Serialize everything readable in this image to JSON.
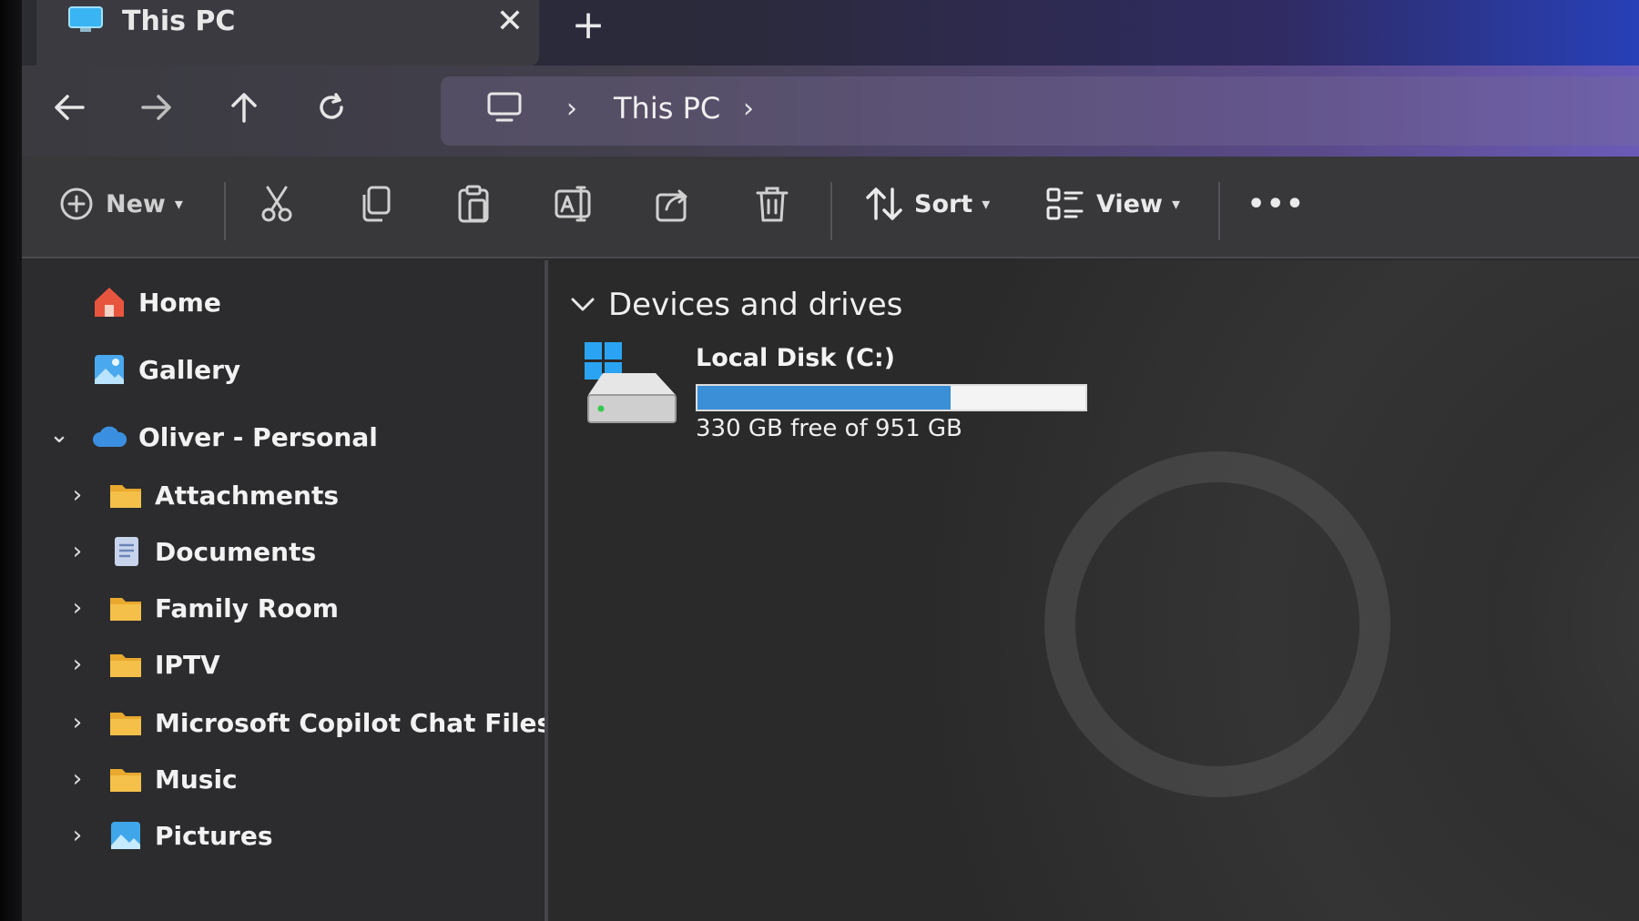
{
  "tab": {
    "title": "This PC",
    "close_glyph": "✕",
    "new_glyph": "+"
  },
  "address": {
    "segments": [
      "This PC"
    ]
  },
  "toolbar": {
    "new_label": "New",
    "sort_label": "Sort",
    "view_label": "View",
    "more_glyph": "•••"
  },
  "icons": {
    "back": "arrow-left-icon",
    "forward": "arrow-right-icon",
    "up": "arrow-up-icon",
    "refresh": "refresh-icon",
    "cut": "scissors-icon",
    "copy": "copy-icon",
    "paste": "clipboard-icon",
    "rename": "rename-icon",
    "share": "share-icon",
    "delete": "trash-icon"
  },
  "sidebar": {
    "items": [
      {
        "label": "Home",
        "icon": "home-icon"
      },
      {
        "label": "Gallery",
        "icon": "gallery-icon"
      },
      {
        "label": "Oliver - Personal",
        "icon": "cloud-icon"
      },
      {
        "label": "Attachments",
        "icon": "folder-icon"
      },
      {
        "label": "Documents",
        "icon": "documents-icon"
      },
      {
        "label": "Family Room",
        "icon": "folder-icon"
      },
      {
        "label": "IPTV",
        "icon": "folder-icon"
      },
      {
        "label": "Microsoft Copilot Chat Files",
        "icon": "folder-icon"
      },
      {
        "label": "Music",
        "icon": "folder-icon"
      },
      {
        "label": "Pictures",
        "icon": "pictures-icon"
      }
    ]
  },
  "main": {
    "group_title": "Devices and drives",
    "drives": [
      {
        "name": "Local Disk (C:)",
        "space_text": "330 GB free of 951 GB",
        "used_fraction": 0.653
      }
    ]
  },
  "colors": {
    "accent": "#3a8fd6",
    "folder": "#f4c04a",
    "home": "#e8553e",
    "cloud": "#3b8fe0"
  }
}
